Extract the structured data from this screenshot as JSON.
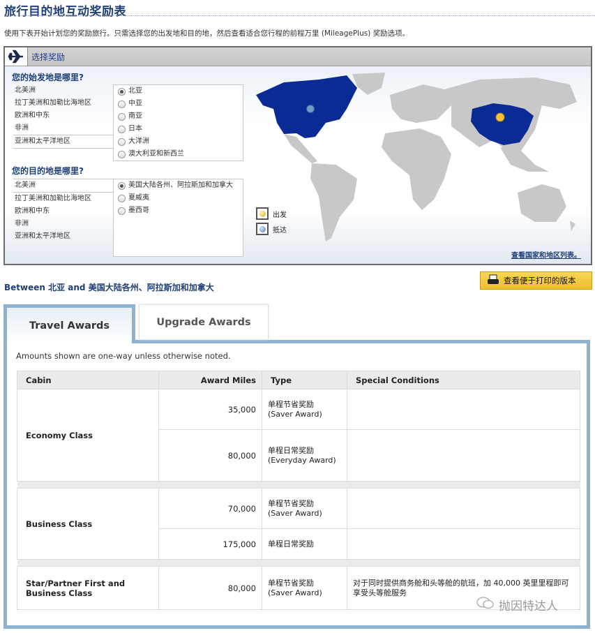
{
  "page": {
    "title": "旅行目的地互动奖励表",
    "intro": "使用下表开始计划您的奖励旅行。只需选择您的出发地和目的地，然后查看适合您行程的前程万里 (MileagePlus) 奖励选项。"
  },
  "selector": {
    "header_label": "选择奖励",
    "origin": {
      "question": "您的始发地是哪里?",
      "regions": [
        "北美洲",
        "拉丁美洲和加勒比海地区",
        "欧洲和中东",
        "非洲",
        "亚洲和太平洋地区"
      ],
      "selected_region": "亚洲和太平洋地区",
      "subregions": [
        "北亚",
        "中亚",
        "南亚",
        "日本",
        "大洋洲",
        "澳大利亚和新西兰"
      ],
      "selected_subregion": "北亚"
    },
    "destination": {
      "question": "您的目的地是哪里?",
      "regions": [
        "北美洲",
        "拉丁美洲和加勒比海地区",
        "欧洲和中东",
        "非洲",
        "亚洲和太平洋地区"
      ],
      "selected_region": "北美洲",
      "subregions": [
        "美国大陆各州、阿拉斯加和加拿大",
        "夏威夷",
        "墨西哥"
      ],
      "selected_subregion": "美国大陆各州、阿拉斯加和加拿大"
    },
    "legend": {
      "depart": "出发",
      "arrive": "抵达"
    },
    "map_link": "查看国家和地区列表。",
    "colors": {
      "highlight": "#0a2a94",
      "land": "#c8c8c8",
      "depart_pin": "#f2c23a",
      "arrive_pin": "#6f9ccb"
    }
  },
  "between": "Between 北亚 and 美国大陆各州、阿拉斯加和加拿大",
  "print_button": "查看便于打印的版本",
  "tabs": [
    {
      "label": "Travel Awards",
      "active": true
    },
    {
      "label": "Upgrade Awards",
      "active": false
    }
  ],
  "note": "Amounts shown are one-way unless otherwise noted.",
  "table": {
    "headers": [
      "Cabin",
      "Award Miles",
      "Type",
      "Special Conditions"
    ],
    "groups": [
      {
        "cabin": "Economy Class",
        "rows": [
          {
            "miles": "35,000",
            "type": "单程节省奖励 (Saver Award)",
            "conditions": ""
          },
          {
            "miles": "80,000",
            "type": "单程日常奖励 (Everyday Award)",
            "conditions": ""
          }
        ]
      },
      {
        "cabin": "Business Class",
        "rows": [
          {
            "miles": "70,000",
            "type": "单程节省奖励 (Saver Award)",
            "conditions": ""
          },
          {
            "miles": "175,000",
            "type": "单程日常奖励",
            "conditions": ""
          }
        ]
      },
      {
        "cabin": "Star/Partner First and Business Class",
        "rows": [
          {
            "miles": "80,000",
            "type": "单程节省奖励 (Saver Award)",
            "conditions": "对于同时提供商务舱和头等舱的航班，加 40,000 英里里程即可享受头等舱服务"
          }
        ]
      }
    ]
  },
  "watermark": "抛因特达人"
}
